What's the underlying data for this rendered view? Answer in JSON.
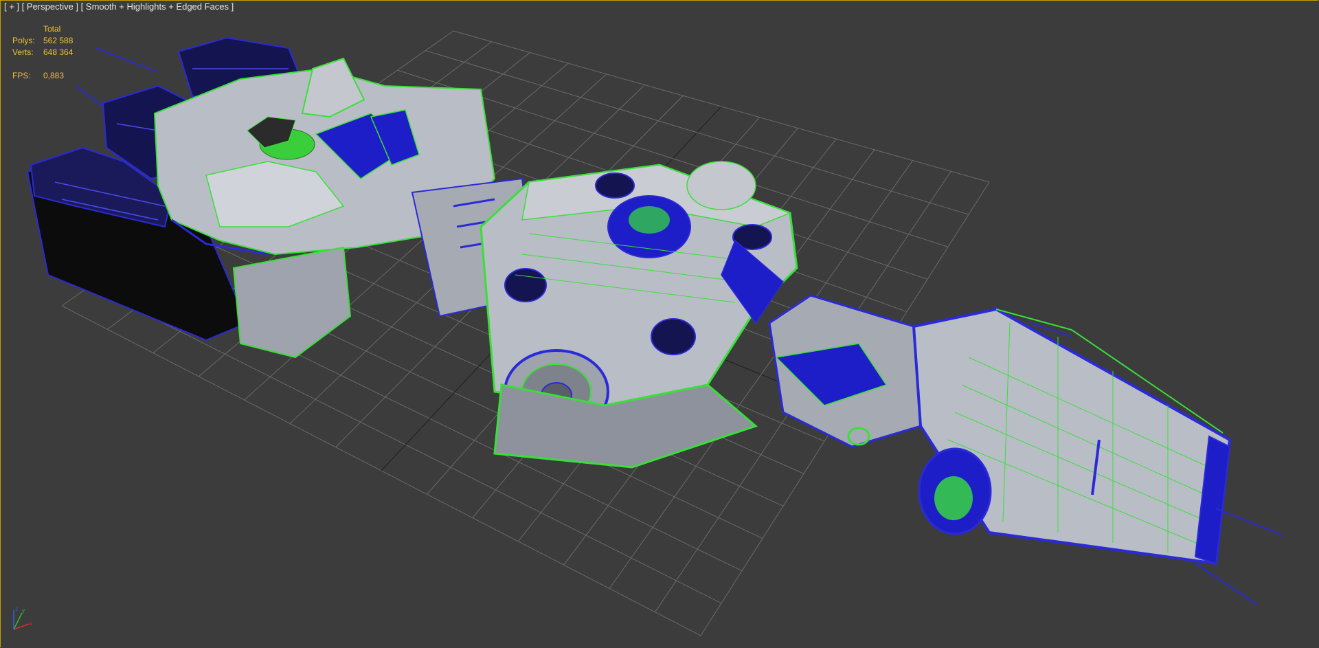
{
  "viewport": {
    "label_parts": [
      "[ + ]",
      "[ Perspective ]",
      "[ Smooth + Highlights + Edged Faces ]"
    ],
    "background": "#3c3c3c"
  },
  "stats": {
    "header": "Total",
    "polys_label": "Polys:",
    "polys_value": "562 588",
    "verts_label": "Verts:",
    "verts_value": "648 364",
    "fps_label": "FPS:",
    "fps_value": "0,883",
    "color": "#f0c23a"
  },
  "colors": {
    "grid": "#6a6a6a",
    "grid_axis": "#1e1e1e",
    "hull": "#b9bdc6",
    "hull_dark": "#8d929c",
    "edge_green": "#38e038",
    "edge_blue": "#2a2ad8",
    "shadow": "#0a0a0a"
  },
  "gizmo": {
    "x_label": "x",
    "y_label": "y",
    "z_label": "z"
  }
}
